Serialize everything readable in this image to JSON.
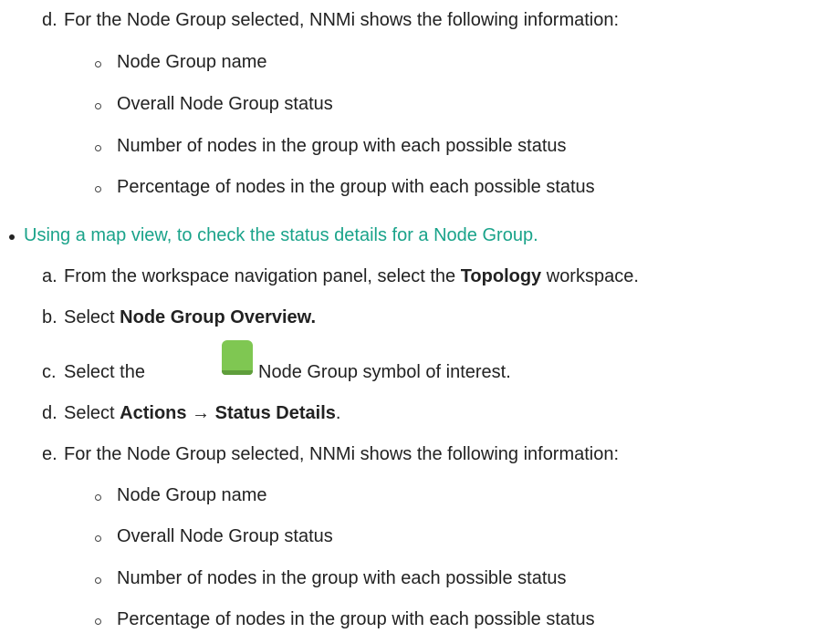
{
  "first_list": {
    "item_d": {
      "marker": "d.",
      "text": "For the Node Group selected, NNMi shows the following information:"
    },
    "bullets": [
      "Node Group name",
      "Overall Node Group status",
      "Number of nodes in the group with each possible status",
      "Percentage of nodes in the group with each possible status"
    ]
  },
  "section_link": "Using a map view, to check the status details for a Node Group.",
  "steps": {
    "a": {
      "marker": "a.",
      "pre": "From the workspace navigation panel, select the ",
      "bold": "Topology",
      "post": " workspace."
    },
    "b": {
      "marker": "b.",
      "pre": "Select ",
      "bold": "Node Group Overview."
    },
    "c": {
      "marker": "c.",
      "pre": "Select the",
      "post": "Node Group symbol of interest.",
      "icon": "node-group-symbol-icon",
      "icon_color": "#7fc752"
    },
    "d": {
      "marker": "d.",
      "pre": "Select ",
      "bold1": "Actions",
      "arrow": " → ",
      "bold2": "Status Details",
      "post": "."
    },
    "e": {
      "marker": "e.",
      "text": "For the Node Group selected, NNMi shows the following information:"
    }
  },
  "second_bullets": [
    "Node Group name",
    "Overall Node Group status",
    "Number of nodes in the group with each possible status",
    "Percentage of nodes in the group with each possible status"
  ],
  "colors": {
    "link": "#1aa38a",
    "text": "#222222"
  }
}
